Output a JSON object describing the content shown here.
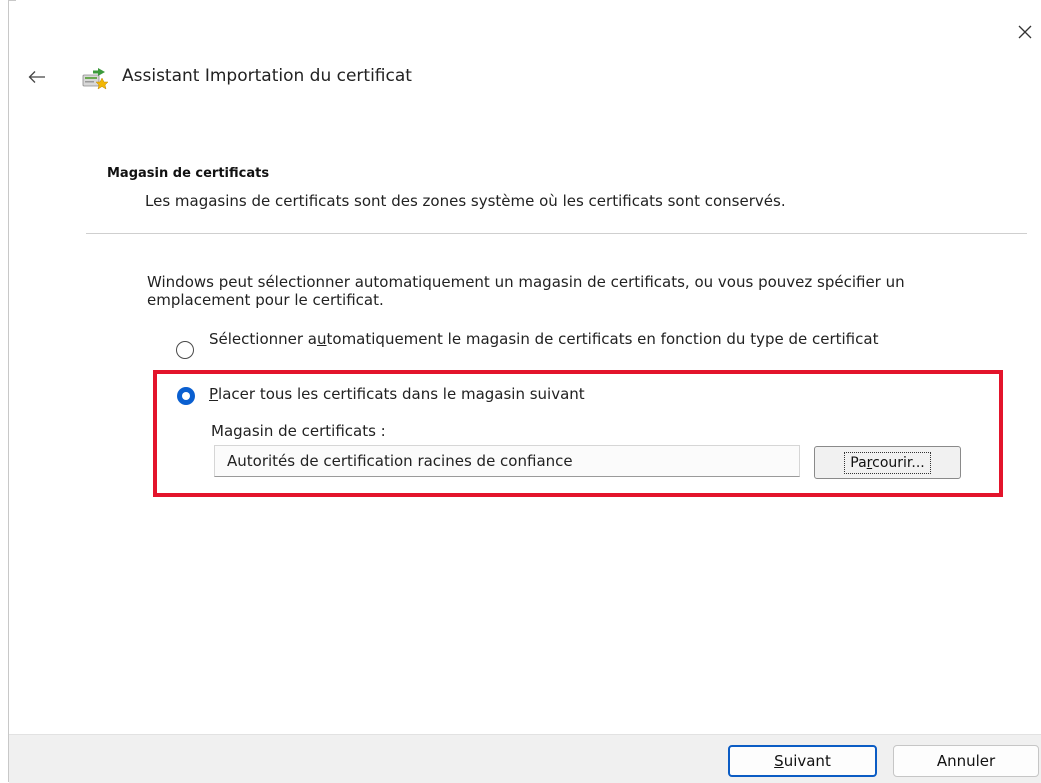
{
  "window": {
    "title": "Assistant Importation du certificat"
  },
  "section": {
    "title": "Magasin de certificats",
    "subtitle": "Les magasins de certificats sont des zones système où les certificats sont conservés."
  },
  "description": "Windows peut sélectionner automatiquement un magasin de certificats, ou vous pouvez spécifier un emplacement pour le certificat.",
  "options": [
    {
      "pre": "Sélectionner a",
      "accel": "u",
      "post": "tomatiquement le magasin de certificats en fonction du type de certificat",
      "selected": false
    },
    {
      "pre": "",
      "accel": "P",
      "post": "lacer tous les certificats dans le magasin suivant",
      "selected": true
    }
  ],
  "store": {
    "label": "Magasin de certificats :",
    "value": "Autorités de certification racines de confiance",
    "browse_pre": "Pa",
    "browse_accel": "r",
    "browse_post": "courir..."
  },
  "footer": {
    "next_accel": "S",
    "next_rest": "uivant",
    "cancel_label": "Annuler"
  },
  "colors": {
    "accent": "#0a5fd0",
    "highlight": "#e3142b"
  },
  "icons": {
    "close": "close-icon",
    "back": "back-arrow-icon",
    "title": "certificate-wizard-icon"
  }
}
